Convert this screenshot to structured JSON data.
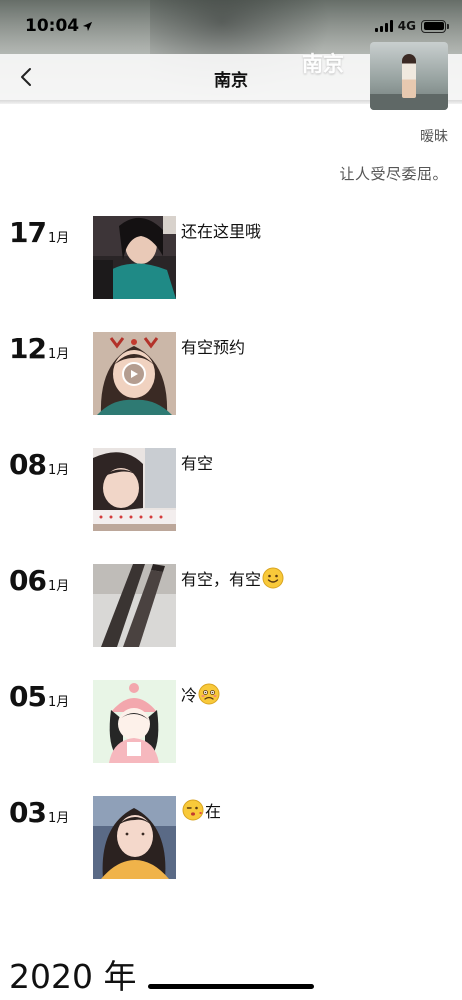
{
  "status_bar": {
    "time": "10:04",
    "network": "4G"
  },
  "nav": {
    "title": "南京",
    "back_icon": "chevron-left-icon"
  },
  "profile": {
    "cover_name": "南京",
    "nickname": "暧昧",
    "signature": "让人受尽委屈。"
  },
  "posts": [
    {
      "day": "17",
      "month": "1月",
      "caption": "还在这里哦",
      "emoji_after": "",
      "emoji_before": "",
      "thumb": "photo",
      "video": false
    },
    {
      "day": "12",
      "month": "1月",
      "caption": "有空预约",
      "emoji_after": "",
      "emoji_before": "",
      "thumb": "photo",
      "video": true
    },
    {
      "day": "08",
      "month": "1月",
      "caption": "有空",
      "emoji_after": "",
      "emoji_before": "",
      "thumb": "photo",
      "video": false
    },
    {
      "day": "06",
      "month": "1月",
      "caption": "有空，有空",
      "emoji_after": "smile-emoji-icon",
      "emoji_before": "",
      "thumb": "photo",
      "video": false
    },
    {
      "day": "05",
      "month": "1月",
      "caption": "冷",
      "emoji_after": "worried-emoji-icon",
      "emoji_before": "",
      "thumb": "illustration",
      "video": false
    },
    {
      "day": "03",
      "month": "1月",
      "caption": "在",
      "emoji_after": "",
      "emoji_before": "wink-kiss-emoji-icon",
      "thumb": "photo",
      "video": false
    }
  ],
  "year_label": "2020 年"
}
